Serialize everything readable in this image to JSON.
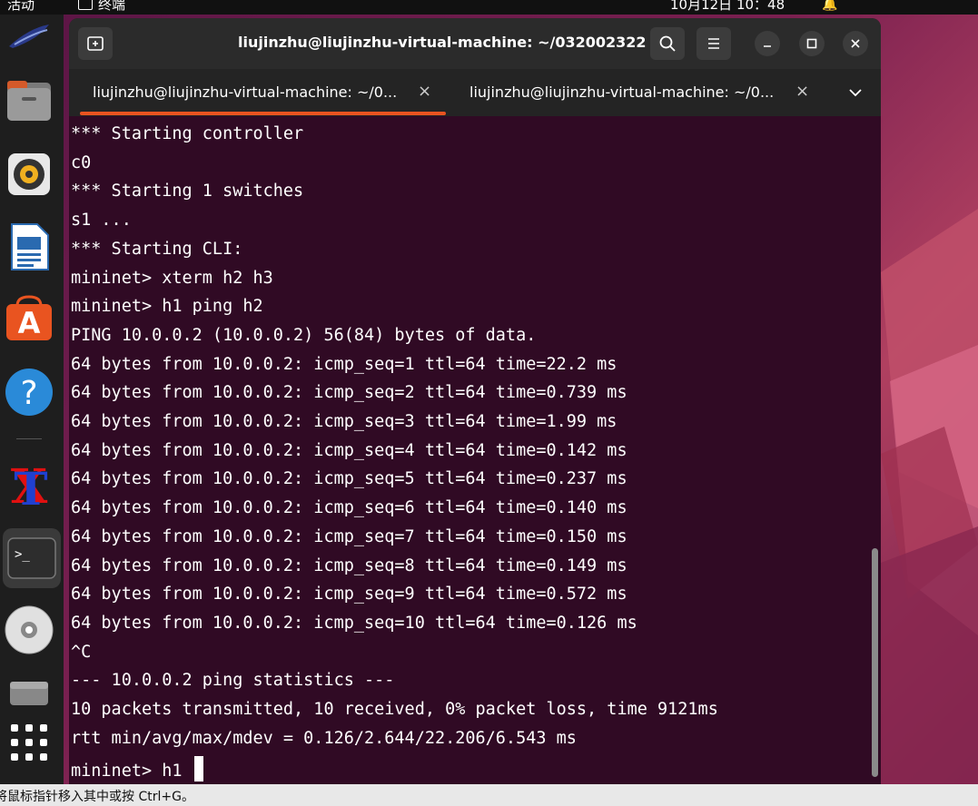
{
  "topbar": {
    "activities": "活动",
    "app_name": "终端",
    "clock": "10月12日  10：48"
  },
  "window": {
    "title": "liujinzhu@liujinzhu-virtual-machine: ~/032002322",
    "tabs": [
      {
        "label": "liujinzhu@liujinzhu-virtual-machine: ~/0...",
        "close": "×"
      },
      {
        "label": "liujinzhu@liujinzhu-virtual-machine: ~/0...",
        "close": "×"
      }
    ]
  },
  "terminal": {
    "lines": [
      "*** Starting controller",
      "c0",
      "*** Starting 1 switches",
      "s1 ...",
      "*** Starting CLI:",
      "mininet> xterm h2 h3",
      "mininet> h1 ping h2",
      "PING 10.0.0.2 (10.0.0.2) 56(84) bytes of data.",
      "64 bytes from 10.0.0.2: icmp_seq=1 ttl=64 time=22.2 ms",
      "64 bytes from 10.0.0.2: icmp_seq=2 ttl=64 time=0.739 ms",
      "64 bytes from 10.0.0.2: icmp_seq=3 ttl=64 time=1.99 ms",
      "64 bytes from 10.0.0.2: icmp_seq=4 ttl=64 time=0.142 ms",
      "64 bytes from 10.0.0.2: icmp_seq=5 ttl=64 time=0.237 ms",
      "64 bytes from 10.0.0.2: icmp_seq=6 ttl=64 time=0.140 ms",
      "64 bytes from 10.0.0.2: icmp_seq=7 ttl=64 time=0.150 ms",
      "64 bytes from 10.0.0.2: icmp_seq=8 ttl=64 time=0.149 ms",
      "64 bytes from 10.0.0.2: icmp_seq=9 ttl=64 time=0.572 ms",
      "64 bytes from 10.0.0.2: icmp_seq=10 ttl=64 time=0.126 ms",
      "^C",
      "--- 10.0.0.2 ping statistics ---",
      "10 packets transmitted, 10 received, 0% packet loss, time 9121ms",
      "rtt min/avg/max/mdev = 0.126/2.644/22.206/6.543 ms"
    ],
    "prompt": "mininet> h1 "
  },
  "statusbar": {
    "text": "将鼠标指针移入其中或按 Ctrl+G。"
  },
  "colors": {
    "terminal_bg": "#300a24",
    "accent": "#e95420",
    "titlebar_bg": "#2b2b2b",
    "tabbar_bg": "#242424"
  }
}
